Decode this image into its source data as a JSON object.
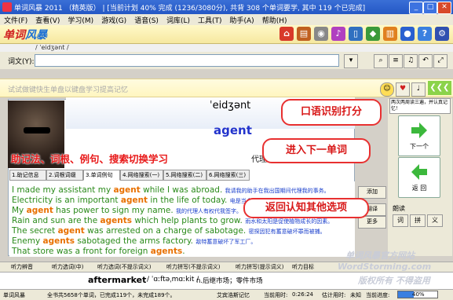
{
  "window": {
    "title": "单词风暴 2011 （精英版） | [当前计划 40% 完成 (1236/3080分), 共背 308 个单词要学, 其中 119 个已完成]"
  },
  "menu": [
    "文件(F)",
    "查看(V)",
    "学习(M)",
    "游戏(G)",
    "语音(S)",
    "词库(L)",
    "工具(T)",
    "助手(A)",
    "帮助(H)"
  ],
  "logo": {
    "part1": "单词",
    "part2": "风暴"
  },
  "phonetic_small": "/ ˈeidʒənt /",
  "word_input": {
    "label": "词文(Y):",
    "value": ""
  },
  "hint_text": "试试做键快生单盘以键盘学习提高记忆",
  "card": {
    "phonetic": "ˈeidʒənt",
    "word": "agent",
    "meaning": "代理商"
  },
  "tabs": [
    "1.助记信息",
    "2.词根词缀",
    "3.单词例句",
    "4.网络搜索(一)",
    "5.网络搜索(二)",
    "6.网络搜索(三)"
  ],
  "active_tab": 2,
  "sentences": [
    {
      "pre": "I made my assistant my ",
      "kw": "agent",
      "post": " while I was abroad.",
      "cn": "我请我的助手在我出国期间代理我的事务。"
    },
    {
      "pre": "Electricity is an important ",
      "kw": "agent",
      "post": " in the life of today.",
      "cn": "电是当今生活中的重要动力。"
    },
    {
      "pre": "My ",
      "kw": "agent",
      "post": " has power to sign my name.",
      "cn": "我的代理人有权代我签字。"
    },
    {
      "pre": "Rain and sun are the ",
      "kw": "agents",
      "post": " which help plants to grow.",
      "cn": "雨水和太阳是促使植物成长的因素。"
    },
    {
      "pre": "The secret ",
      "kw": "agent",
      "post": " was arrested on a charge of sabotage.",
      "cn": "密探因犯有蓄意破坏罪而被捕。"
    },
    {
      "pre": "Enemy ",
      "kw": "agents",
      "post": " sabotaged the arms factory.",
      "cn": "敌特蓄意破坏了军工厂。"
    },
    {
      "pre": "That store was a front for foreign ",
      "kw": "agents",
      "post": ".",
      "cn": ""
    }
  ],
  "side_buttons": [
    "添加",
    "翻译",
    "更多"
  ],
  "right_panel": {
    "note": "两次两周读三遍，并认真记忆！",
    "next_label": "下一个",
    "back_label": "返 回",
    "read_label": "朗读",
    "read_buttons": [
      "词",
      "拼",
      "义"
    ]
  },
  "annotations": {
    "left": "助记法、词根、例句、搜索切换学习",
    "speech": "口语识别打分",
    "next": "进入下一单词",
    "back": "返回认知其他选项"
  },
  "bottom_tabs": [
    "听力辨音",
    "听力选词(中)",
    "听力选词(不提示词义)",
    "听力拼写(不提示词义)",
    "听力拼写(提示词义)",
    "听力目标"
  ],
  "footer_word": {
    "word": "aftermarket",
    "phonetic": "/ ˈɑːftəˌmɑːkit /",
    "meaning": "n.后继市场；零件市场"
  },
  "status": {
    "app": "单词风暴",
    "summary": "全书共5658个单词，已完成119个，未完成189个。",
    "mode": "艾宾浩斯记忆",
    "time_label": "当前用时:",
    "time": "0:26:24",
    "est_label": "估计用时:",
    "est": "未知",
    "progress_label": "当前进度:",
    "progress_value": "40%",
    "progress": 0.4
  },
  "watermark": [
    "单词风暴官方网站",
    "WordStorming.com",
    "版权所有 不得盗用"
  ],
  "colors": {
    "accent": "#2457c5",
    "sentence": "#2a8a1a",
    "keyword": "#e87000",
    "callout": "#e83030"
  }
}
